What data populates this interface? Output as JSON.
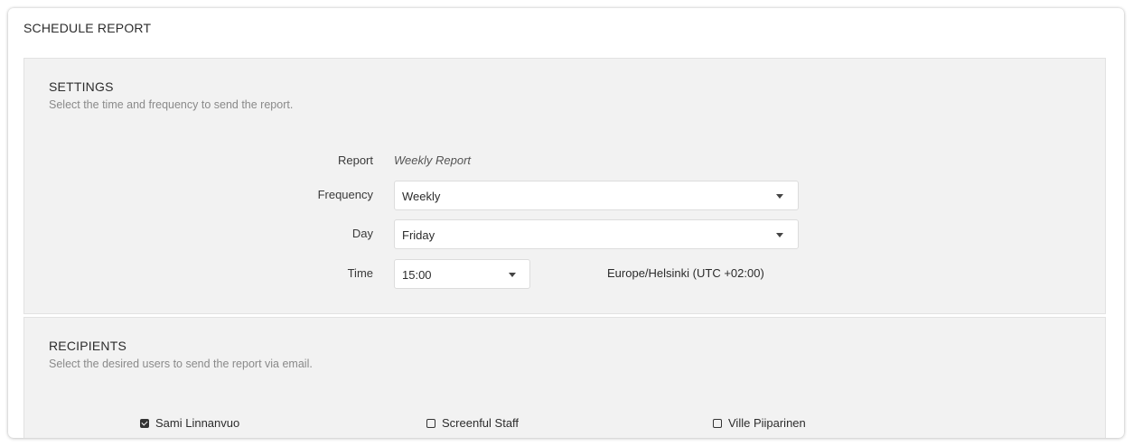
{
  "dialog": {
    "title": "SCHEDULE REPORT"
  },
  "settings": {
    "title": "SETTINGS",
    "description": "Select the time and frequency to send the report.",
    "report_label": "Report",
    "report_value": "Weekly Report",
    "frequency_label": "Frequency",
    "frequency_value": "Weekly",
    "day_label": "Day",
    "day_value": "Friday",
    "time_label": "Time",
    "time_value": "15:00",
    "timezone": "Europe/Helsinki (UTC +02:00)"
  },
  "recipients": {
    "title": "RECIPIENTS",
    "description": "Select the desired users to send the report via email.",
    "items": [
      {
        "name": "Sami Linnanvuo",
        "checked": true
      },
      {
        "name": "Screenful Staff",
        "checked": false
      },
      {
        "name": "Ville Piiparinen",
        "checked": false
      }
    ]
  },
  "icons": {
    "dropdown": "caret-down-icon",
    "checkbox_checked": "checkbox-checked-icon",
    "checkbox_unchecked": "checkbox-unchecked-icon"
  }
}
